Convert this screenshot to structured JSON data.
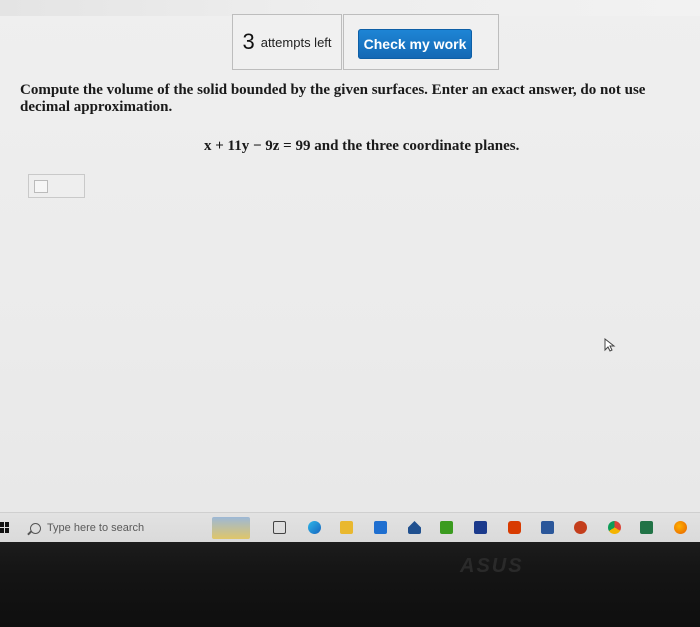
{
  "header": {
    "attempts_count": "3",
    "attempts_label": "attempts left",
    "check_button_label": "Check my work"
  },
  "question": {
    "prompt": "Compute the volume of the solid bounded by the given surfaces. Enter an exact answer, do not use decimal approximation.",
    "equation": "x + 11y − 9z = 99 and the three coordinate planes."
  },
  "answer": {
    "value": ""
  },
  "taskbar": {
    "search_placeholder": "Type here to search",
    "icons": [
      "task-view",
      "edge",
      "file-explorer",
      "store",
      "mail",
      "nvidia",
      "paint",
      "office",
      "word",
      "powerpoint",
      "chrome",
      "excel",
      "firefox"
    ]
  },
  "brand": "ASUS",
  "colors": {
    "button_blue": "#1a74c4",
    "page_bg": "#ececec",
    "taskbar_bg": "#dedede"
  }
}
